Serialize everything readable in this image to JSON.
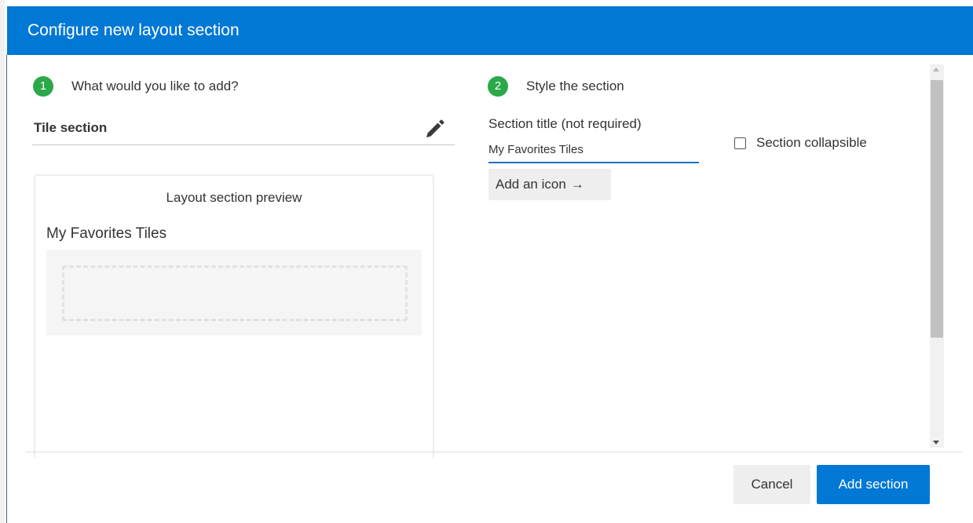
{
  "dialog": {
    "title": "Configure new layout section"
  },
  "step1": {
    "number": "1",
    "label": "What would you like to add?",
    "selection": "Tile section",
    "edit_icon": "pencil-icon"
  },
  "preview": {
    "heading": "Layout section preview",
    "section_title": "My Favorites Tiles"
  },
  "step2": {
    "number": "2",
    "label": "Style the section",
    "title_field_label": "Section title (not required)",
    "title_field_value": "My Favorites Tiles",
    "add_icon_label": "Add an icon",
    "add_icon_arrow": "→",
    "collapsible_label": "Section collapsible",
    "collapsible_checked": false
  },
  "footer": {
    "cancel_label": "Cancel",
    "add_label": "Add section"
  },
  "colors": {
    "header": "#0078d4",
    "step_badge": "#2aa84a",
    "input_underline": "#1b73c3",
    "primary_button": "#0078d4"
  }
}
